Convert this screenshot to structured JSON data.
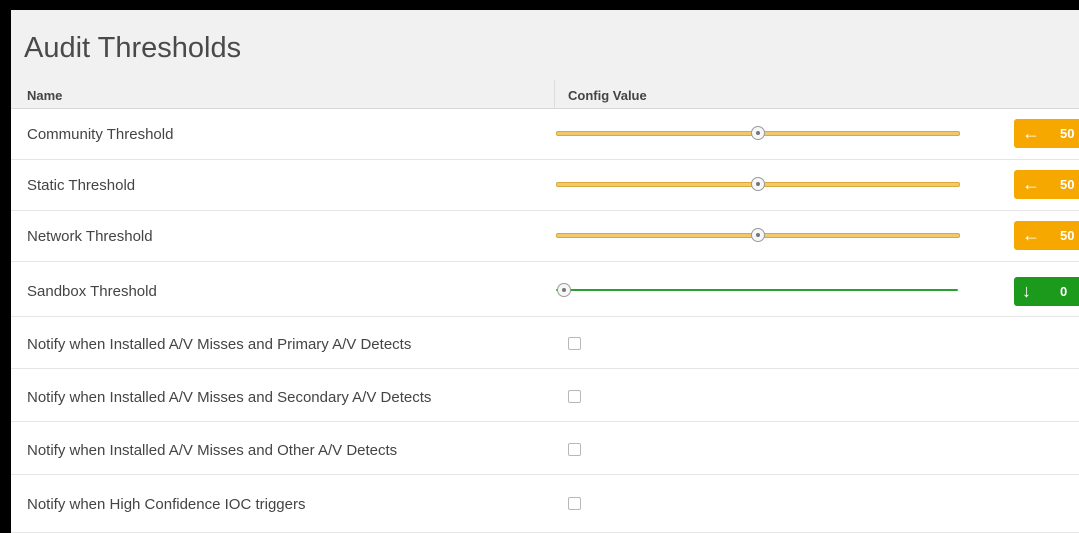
{
  "panel": {
    "title": "Audit Thresholds",
    "columns": {
      "name": "Name",
      "config": "Config Value"
    }
  },
  "rows": [
    {
      "label": "Community Threshold",
      "type": "slider",
      "value": "50",
      "percent": 50,
      "color": "#f6a800",
      "arrow": "←"
    },
    {
      "label": "Static Threshold",
      "type": "slider",
      "value": "50",
      "percent": 50,
      "color": "#f6a800",
      "arrow": "←"
    },
    {
      "label": "Network Threshold",
      "type": "slider",
      "value": "50",
      "percent": 50,
      "color": "#f6a800",
      "arrow": "←"
    },
    {
      "label": "Sandbox Threshold",
      "type": "slider",
      "value": "0",
      "percent": 0,
      "color": "#1c9a1c",
      "arrow": "↓"
    },
    {
      "label": "Notify when Installed A/V Misses and Primary A/V Detects",
      "type": "checkbox",
      "checked": false
    },
    {
      "label": "Notify when Installed A/V Misses and Secondary A/V Detects",
      "type": "checkbox",
      "checked": false
    },
    {
      "label": "Notify when Installed A/V Misses and Other A/V Detects",
      "type": "checkbox",
      "checked": false
    },
    {
      "label": "Notify when High Confidence IOC triggers",
      "type": "checkbox",
      "checked": false
    }
  ]
}
